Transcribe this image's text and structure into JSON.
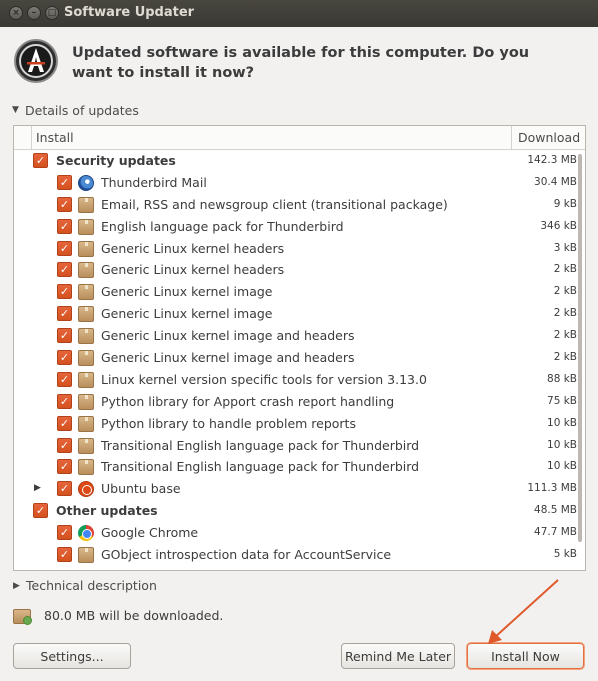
{
  "window": {
    "title": "Software Updater",
    "close_glyph": "×",
    "minimize_glyph": "–",
    "maximize_glyph": "□"
  },
  "header": {
    "app_icon": "software-updater-icon",
    "headline": "Updated software is available for this computer. Do you want to install it now?"
  },
  "details": {
    "label": "Details of updates",
    "expanded_glyph": "▼"
  },
  "table": {
    "columns": {
      "install": "Install",
      "download": "Download"
    },
    "rows": [
      {
        "level": 0,
        "checked": true,
        "label": "Security updates",
        "size": "142.3 MB"
      },
      {
        "level": 1,
        "checked": true,
        "icon": "thunderbird-icon",
        "label": "Thunderbird Mail",
        "size": "30.4 MB"
      },
      {
        "level": 1,
        "checked": true,
        "icon": "package-icon",
        "label": "Email, RSS and newsgroup client (transitional package)",
        "size": "9 kB"
      },
      {
        "level": 1,
        "checked": true,
        "icon": "package-icon",
        "label": "English language pack for Thunderbird",
        "size": "346 kB"
      },
      {
        "level": 1,
        "checked": true,
        "icon": "package-icon",
        "label": "Generic Linux kernel headers",
        "size": "3 kB"
      },
      {
        "level": 1,
        "checked": true,
        "icon": "package-icon",
        "label": "Generic Linux kernel headers",
        "size": "2 kB"
      },
      {
        "level": 1,
        "checked": true,
        "icon": "package-icon",
        "label": "Generic Linux kernel image",
        "size": "2 kB"
      },
      {
        "level": 1,
        "checked": true,
        "icon": "package-icon",
        "label": "Generic Linux kernel image",
        "size": "2 kB"
      },
      {
        "level": 1,
        "checked": true,
        "icon": "package-icon",
        "label": "Generic Linux kernel image and headers",
        "size": "2 kB"
      },
      {
        "level": 1,
        "checked": true,
        "icon": "package-icon",
        "label": "Generic Linux kernel image and headers",
        "size": "2 kB"
      },
      {
        "level": 1,
        "checked": true,
        "icon": "package-icon",
        "label": "Linux kernel version specific tools for version 3.13.0",
        "size": "88 kB"
      },
      {
        "level": 1,
        "checked": true,
        "icon": "package-icon",
        "label": "Python library for Apport crash report handling",
        "size": "75 kB"
      },
      {
        "level": 1,
        "checked": true,
        "icon": "package-icon",
        "label": "Python library to handle problem reports",
        "size": "10 kB"
      },
      {
        "level": 1,
        "checked": true,
        "icon": "package-icon",
        "label": "Transitional English language pack for Thunderbird",
        "size": "10 kB"
      },
      {
        "level": 1,
        "checked": true,
        "icon": "package-icon",
        "label": "Transitional English language pack for Thunderbird",
        "size": "10 kB"
      },
      {
        "level": 1,
        "checked": true,
        "icon": "ubuntu-icon",
        "label": "Ubuntu base",
        "size": "111.3 MB",
        "collapsed_glyph": "▶"
      },
      {
        "level": 0,
        "checked": true,
        "label": "Other updates",
        "size": "48.5 MB"
      },
      {
        "level": 1,
        "checked": true,
        "icon": "chrome-icon",
        "label": "Google Chrome",
        "size": "47.7 MB"
      },
      {
        "level": 1,
        "checked": true,
        "icon": "package-icon",
        "label": "GObject introspection data for AccountService",
        "size": "5 kB"
      }
    ],
    "check_glyph": "✓"
  },
  "technical": {
    "label": "Technical description",
    "collapsed_glyph": "▶"
  },
  "download_info": {
    "icon": "package-download-icon",
    "text": "80.0 MB will be downloaded."
  },
  "buttons": {
    "settings": "Settings...",
    "remind": "Remind Me Later",
    "install": "Install Now"
  },
  "colors": {
    "checkbox": "#dd5a2a",
    "titlebar": "#3f3e39",
    "annotation_arrow": "#e0592b"
  }
}
